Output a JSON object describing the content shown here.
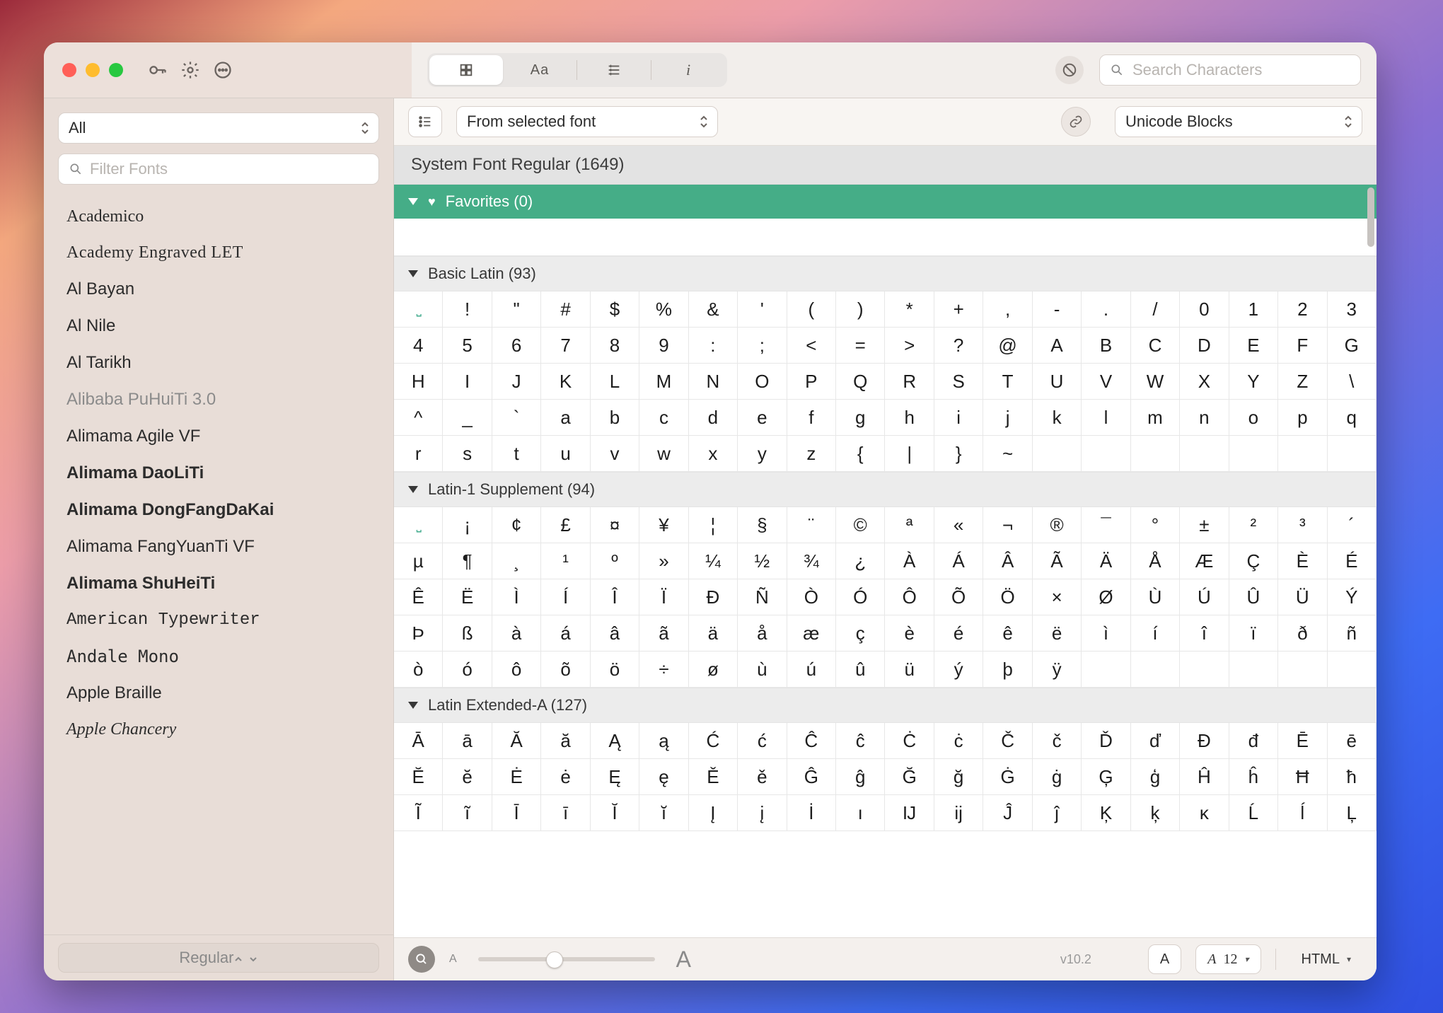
{
  "sidebar": {
    "category": "All",
    "filter_placeholder": "Filter Fonts",
    "fonts": [
      {
        "name": "Academico",
        "style": "font-family:Georgia,serif"
      },
      {
        "name": "Academy Engraved LET",
        "style": "font-family:'Times New Roman',serif;font-weight:400;letter-spacing:.5px"
      },
      {
        "name": "Al Bayan",
        "style": ""
      },
      {
        "name": "Al Nile",
        "style": ""
      },
      {
        "name": "Al Tarikh",
        "style": ""
      },
      {
        "name": "Alibaba PuHuiTi 3.0",
        "style": "color:#8b8b8b;font-weight:300"
      },
      {
        "name": "Alimama Agile VF",
        "style": ""
      },
      {
        "name": "Alimama DaoLiTi",
        "style": "font-weight:600"
      },
      {
        "name": "Alimama DongFangDaKai",
        "style": "font-weight:700"
      },
      {
        "name": "Alimama FangYuanTi VF",
        "style": ""
      },
      {
        "name": "Alimama ShuHeiTi",
        "style": "font-weight:700"
      },
      {
        "name": "American Typewriter",
        "style": "font-family:'American Typewriter','Courier New',serif"
      },
      {
        "name": "Andale Mono",
        "style": "font-family:'Andale Mono',Menlo,monospace"
      },
      {
        "name": "Apple Braille",
        "style": ""
      },
      {
        "name": "Apple Chancery",
        "style": "font-family:'Apple Chancery',cursive;font-style:italic"
      }
    ],
    "style_label": "Regular"
  },
  "toolbar": {
    "source": "From selected font",
    "grouping": "Unicode Blocks",
    "search_placeholder": "Search Characters"
  },
  "header": {
    "font_title": "System Font Regular (1649)"
  },
  "sections": {
    "favorites_label": "Favorites (0)",
    "basic_latin": {
      "label": "Basic Latin (93)",
      "chars": [
        "␣",
        "!",
        "\"",
        "#",
        "$",
        "%",
        "&",
        "'",
        "(",
        ")",
        "*",
        "+",
        ",",
        "-",
        ".",
        "/",
        "0",
        "1",
        "2",
        "3",
        "4",
        "5",
        "6",
        "7",
        "8",
        "9",
        ":",
        ";",
        "<",
        "=",
        ">",
        "?",
        "@",
        "A",
        "B",
        "C",
        "D",
        "E",
        "F",
        "G",
        "H",
        "I",
        "J",
        "K",
        "L",
        "M",
        "N",
        "O",
        "P",
        "Q",
        "R",
        "S",
        "T",
        "U",
        "V",
        "W",
        "X",
        "Y",
        "Z",
        "\\",
        "^",
        "_",
        "`",
        "a",
        "b",
        "c",
        "d",
        "e",
        "f",
        "g",
        "h",
        "i",
        "j",
        "k",
        "l",
        "m",
        "n",
        "o",
        "p",
        "q",
        "r",
        "s",
        "t",
        "u",
        "v",
        "w",
        "x",
        "y",
        "z",
        "{",
        "|",
        "}",
        "~"
      ]
    },
    "latin1": {
      "label": "Latin-1 Supplement (94)",
      "chars": [
        "␣",
        "¡",
        "¢",
        "£",
        "¤",
        "¥",
        "¦",
        "§",
        "¨",
        "©",
        "ª",
        "«",
        "¬",
        "®",
        "¯",
        "°",
        "±",
        "²",
        "³",
        "´",
        "µ",
        "¶",
        "¸",
        "¹",
        "º",
        "»",
        "¼",
        "½",
        "¾",
        "¿",
        "À",
        "Á",
        "Â",
        "Ã",
        "Ä",
        "Å",
        "Æ",
        "Ç",
        "È",
        "É",
        "Ê",
        "Ë",
        "Ì",
        "Í",
        "Î",
        "Ï",
        "Ð",
        "Ñ",
        "Ò",
        "Ó",
        "Ô",
        "Õ",
        "Ö",
        "×",
        "Ø",
        "Ù",
        "Ú",
        "Û",
        "Ü",
        "Ý",
        "Þ",
        "ß",
        "à",
        "á",
        "â",
        "ã",
        "ä",
        "å",
        "æ",
        "ç",
        "è",
        "é",
        "ê",
        "ë",
        "ì",
        "í",
        "î",
        "ï",
        "ð",
        "ñ",
        "ò",
        "ó",
        "ô",
        "õ",
        "ö",
        "÷",
        "ø",
        "ù",
        "ú",
        "û",
        "ü",
        "ý",
        "þ",
        "ÿ"
      ]
    },
    "latin_ext_a": {
      "label": "Latin Extended-A (127)",
      "chars": [
        "Ā",
        "ā",
        "Ă",
        "ă",
        "Ą",
        "ą",
        "Ć",
        "ć",
        "Ĉ",
        "ĉ",
        "Ċ",
        "ċ",
        "Č",
        "č",
        "Ď",
        "ď",
        "Đ",
        "đ",
        "Ē",
        "ē",
        "Ĕ",
        "ĕ",
        "Ė",
        "ė",
        "Ę",
        "ę",
        "Ě",
        "ě",
        "Ĝ",
        "ĝ",
        "Ğ",
        "ğ",
        "Ġ",
        "ġ",
        "Ģ",
        "ģ",
        "Ĥ",
        "ĥ",
        "Ħ",
        "ħ",
        "Ĩ",
        "ĩ",
        "Ī",
        "ī",
        "Ĭ",
        "ĭ",
        "Į",
        "į",
        "İ",
        "ı",
        "Ĳ",
        "ĳ",
        "Ĵ",
        "ĵ",
        "Ķ",
        "ķ",
        "ĸ",
        "Ĺ",
        "ĺ",
        "Ļ"
      ]
    }
  },
  "footer": {
    "version": "v10.2",
    "current_char": "A",
    "codepoint_label": "12",
    "format": "HTML"
  }
}
